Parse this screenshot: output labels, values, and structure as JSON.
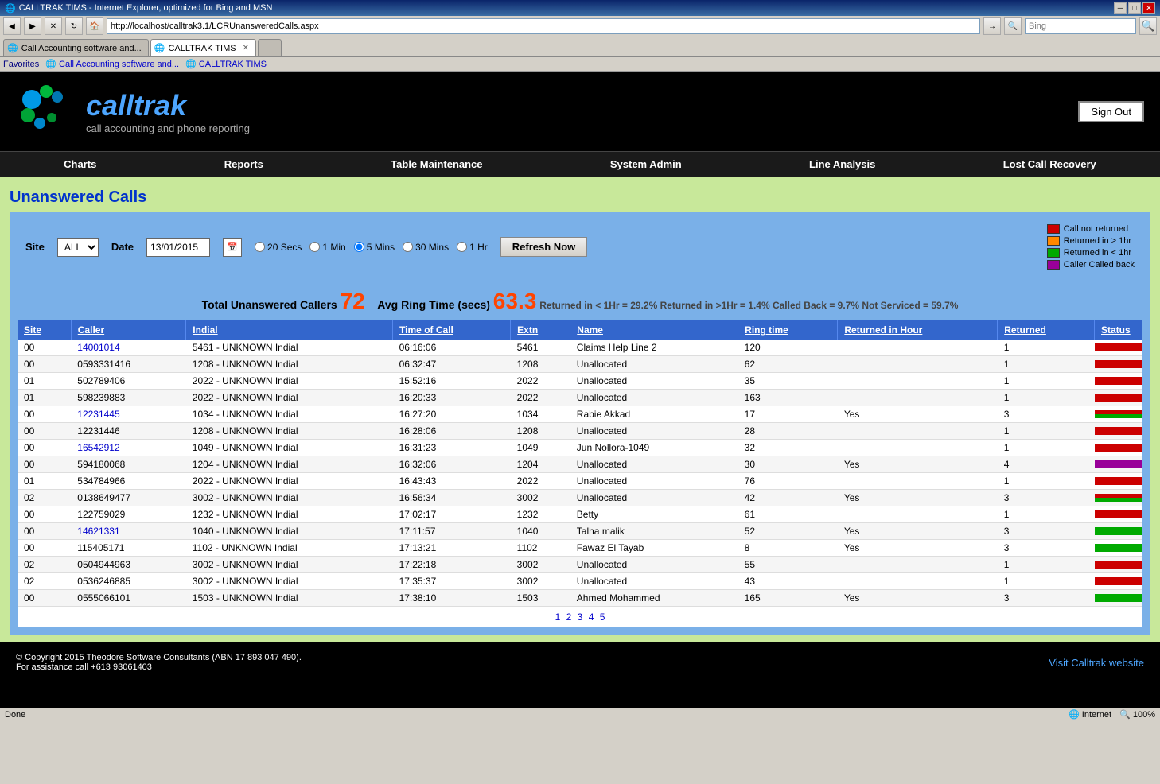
{
  "browser": {
    "title": "CALLTRAK TIMS - Internet Explorer, optimized for Bing and MSN",
    "address": "http://localhost/calltrak3.1/LCRUnansweredCalls.aspx",
    "search_placeholder": "Bing",
    "tabs": [
      {
        "label": "Call Accounting software and...",
        "active": false,
        "icon": "🌐"
      },
      {
        "label": "CALLTRAK TIMS",
        "active": true,
        "icon": "🌐"
      }
    ],
    "favorites_label": "Favorites",
    "favorites_items": [
      "Call Accounting software and...",
      "CALLTRAK TIMS"
    ],
    "status": "Done",
    "status_right": "Internet",
    "zoom": "100%"
  },
  "header": {
    "logo_name": "calltrak",
    "logo_tagline": "call accounting and phone reporting",
    "sign_out_label": "Sign Out"
  },
  "nav": {
    "items": [
      "Charts",
      "Reports",
      "Table Maintenance",
      "System Admin",
      "Line Analysis",
      "Lost Call Recovery"
    ]
  },
  "page": {
    "title": "Unanswered Calls",
    "filter": {
      "site_label": "Site",
      "site_value": "ALL",
      "date_label": "Date",
      "date_value": "13/01/2015",
      "radio_options": [
        "20 Secs",
        "1 Min",
        "5 Mins",
        "30 Mins",
        "1 Hr"
      ],
      "radio_selected": "5 Mins",
      "refresh_label": "Refresh Now"
    },
    "legend": [
      {
        "color": "#cc0000",
        "label": "Call not returned"
      },
      {
        "color": "#ff8800",
        "label": "Returned in > 1hr"
      },
      {
        "color": "#00aa00",
        "label": "Returned in < 1hr"
      },
      {
        "color": "#990099",
        "label": "Caller Called back"
      }
    ],
    "stats": {
      "total_label": "Total Unanswered Callers",
      "total_value": "72",
      "avg_label": "Avg Ring Time (secs)",
      "avg_value": "63.3",
      "summary": "Returned in < 1Hr = 29.2% Returned in >1Hr = 1.4% Called Back = 9.7% Not Serviced = 59.7%"
    },
    "table": {
      "columns": [
        "Site",
        "Caller",
        "Indial",
        "Time of Call",
        "Extn",
        "Name",
        "Ring time",
        "Returned in Hour",
        "Returned",
        "Status"
      ],
      "rows": [
        {
          "site": "00",
          "caller": "14001014",
          "caller_link": true,
          "indial": "5461 - UNKNOWN Indial",
          "time": "06:16:06",
          "extn": "5461",
          "name": "Claims Help Line 2",
          "ring": "120",
          "returned_hour": "",
          "returned": "1",
          "status": [
            {
              "color": "#cc0000",
              "h": 10
            }
          ]
        },
        {
          "site": "00",
          "caller": "0593331416",
          "caller_link": false,
          "indial": "1208 - UNKNOWN Indial",
          "time": "06:32:47",
          "extn": "1208",
          "name": "Unallocated",
          "ring": "62",
          "returned_hour": "",
          "returned": "1",
          "status": [
            {
              "color": "#cc0000",
              "h": 10
            }
          ]
        },
        {
          "site": "01",
          "caller": "502789406",
          "caller_link": false,
          "indial": "2022 - UNKNOWN Indial",
          "time": "15:52:16",
          "extn": "2022",
          "name": "Unallocated",
          "ring": "35",
          "returned_hour": "",
          "returned": "1",
          "status": [
            {
              "color": "#cc0000",
              "h": 10
            }
          ]
        },
        {
          "site": "01",
          "caller": "598239883",
          "caller_link": false,
          "indial": "2022 - UNKNOWN Indial",
          "time": "16:20:33",
          "extn": "2022",
          "name": "Unallocated",
          "ring": "163",
          "returned_hour": "",
          "returned": "1",
          "status": [
            {
              "color": "#cc0000",
              "h": 10
            }
          ]
        },
        {
          "site": "00",
          "caller": "12231445",
          "caller_link": true,
          "indial": "1034 - UNKNOWN Indial",
          "time": "16:27:20",
          "extn": "1034",
          "name": "Rabie Akkad",
          "ring": "17",
          "returned_hour": "Yes",
          "returned": "3",
          "status": [
            {
              "color": "#cc0000",
              "h": 5
            },
            {
              "color": "#00aa00",
              "h": 5
            }
          ]
        },
        {
          "site": "00",
          "caller": "12231446",
          "caller_link": false,
          "indial": "1208 - UNKNOWN Indial",
          "time": "16:28:06",
          "extn": "1208",
          "name": "Unallocated",
          "ring": "28",
          "returned_hour": "",
          "returned": "1",
          "status": [
            {
              "color": "#cc0000",
              "h": 10
            }
          ]
        },
        {
          "site": "00",
          "caller": "16542912",
          "caller_link": true,
          "indial": "1049 - UNKNOWN Indial",
          "time": "16:31:23",
          "extn": "1049",
          "name": "Jun Nollora-1049",
          "ring": "32",
          "returned_hour": "",
          "returned": "1",
          "status": [
            {
              "color": "#cc0000",
              "h": 10
            }
          ]
        },
        {
          "site": "00",
          "caller": "594180068",
          "caller_link": false,
          "indial": "1204 - UNKNOWN Indial",
          "time": "16:32:06",
          "extn": "1204",
          "name": "Unallocated",
          "ring": "30",
          "returned_hour": "Yes",
          "returned": "4",
          "status": [
            {
              "color": "#990099",
              "h": 10
            }
          ]
        },
        {
          "site": "01",
          "caller": "534784966",
          "caller_link": false,
          "indial": "2022 - UNKNOWN Indial",
          "time": "16:43:43",
          "extn": "2022",
          "name": "Unallocated",
          "ring": "76",
          "returned_hour": "",
          "returned": "1",
          "status": [
            {
              "color": "#cc0000",
              "h": 10
            }
          ]
        },
        {
          "site": "02",
          "caller": "0138649477",
          "caller_link": false,
          "indial": "3002 - UNKNOWN Indial",
          "time": "16:56:34",
          "extn": "3002",
          "name": "Unallocated",
          "ring": "42",
          "returned_hour": "Yes",
          "returned": "3",
          "status": [
            {
              "color": "#cc0000",
              "h": 5
            },
            {
              "color": "#00aa00",
              "h": 5
            }
          ]
        },
        {
          "site": "00",
          "caller": "122759029",
          "caller_link": false,
          "indial": "1232 - UNKNOWN Indial",
          "time": "17:02:17",
          "extn": "1232",
          "name": "Betty",
          "ring": "61",
          "returned_hour": "",
          "returned": "1",
          "status": [
            {
              "color": "#cc0000",
              "h": 10
            }
          ]
        },
        {
          "site": "00",
          "caller": "14621331",
          "caller_link": true,
          "indial": "1040 - UNKNOWN Indial",
          "time": "17:11:57",
          "extn": "1040",
          "name": "Talha malik",
          "ring": "52",
          "returned_hour": "Yes",
          "returned": "3",
          "status": [
            {
              "color": "#00aa00",
              "h": 10
            }
          ]
        },
        {
          "site": "00",
          "caller": "115405171",
          "caller_link": false,
          "indial": "1102 - UNKNOWN Indial",
          "time": "17:13:21",
          "extn": "1102",
          "name": "Fawaz El Tayab",
          "ring": "8",
          "returned_hour": "Yes",
          "returned": "3",
          "status": [
            {
              "color": "#00aa00",
              "h": 10
            }
          ]
        },
        {
          "site": "02",
          "caller": "0504944963",
          "caller_link": false,
          "indial": "3002 - UNKNOWN Indial",
          "time": "17:22:18",
          "extn": "3002",
          "name": "Unallocated",
          "ring": "55",
          "returned_hour": "",
          "returned": "1",
          "status": [
            {
              "color": "#cc0000",
              "h": 10
            }
          ]
        },
        {
          "site": "02",
          "caller": "0536246885",
          "caller_link": false,
          "indial": "3002 - UNKNOWN Indial",
          "time": "17:35:37",
          "extn": "3002",
          "name": "Unallocated",
          "ring": "43",
          "returned_hour": "",
          "returned": "1",
          "status": [
            {
              "color": "#cc0000",
              "h": 10
            }
          ]
        },
        {
          "site": "00",
          "caller": "0555066101",
          "caller_link": false,
          "indial": "1503 - UNKNOWN Indial",
          "time": "17:38:10",
          "extn": "1503",
          "name": "Ahmed Mohammed",
          "ring": "165",
          "returned_hour": "Yes",
          "returned": "3",
          "status": [
            {
              "color": "#00aa00",
              "h": 10
            }
          ]
        }
      ],
      "pagination": [
        "1",
        "2",
        "3",
        "4",
        "5"
      ]
    }
  },
  "footer": {
    "copyright": "© Copyright 2015 Theodore Software Consultants (ABN 17 893 047 490).",
    "support": "For assistance call +613 93061403",
    "visit_label": "Visit Calltrak website"
  }
}
